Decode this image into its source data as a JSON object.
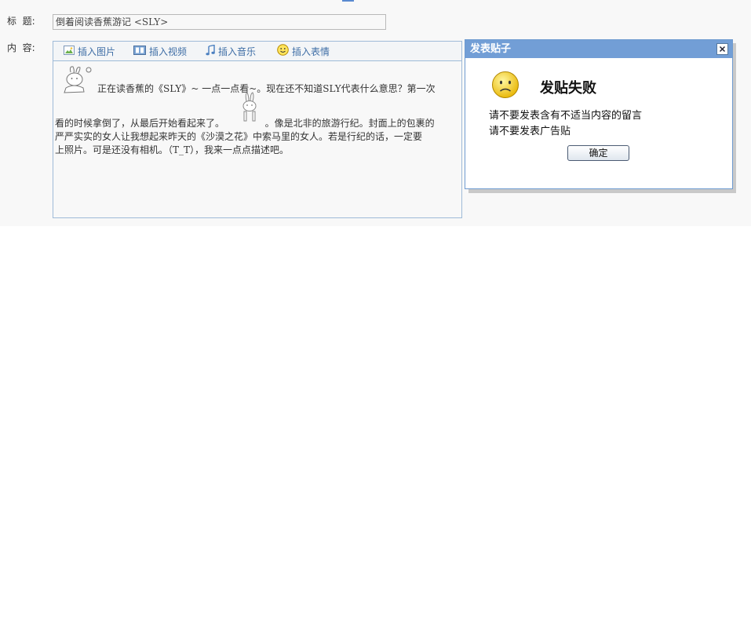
{
  "form": {
    "title_label": "标  题:",
    "title_value": "倒着阅读香蕉游记 <SLY>",
    "content_label": "内  容:"
  },
  "toolbar": {
    "items": [
      {
        "label": "插入图片",
        "icon": "image-icon"
      },
      {
        "label": "插入视频",
        "icon": "video-icon"
      },
      {
        "label": "插入音乐",
        "icon": "music-note-icon"
      },
      {
        "label": "插入表情",
        "icon": "smiley-icon"
      }
    ]
  },
  "content": {
    "line1": "正在读香蕉的《SLY》~ 一点一点看~。现在还不知道SLY代表什么意思？第一次",
    "line2a": "看的时候拿倒了，从最后开始看起来了。",
    "line2b": "。像是北非的旅游行纪。封面上的包裹的",
    "line3": "严严实实的女人让我想起来昨天的《沙漠之花》中索马里的女人。若是行纪的话，一定要",
    "line4": "上照片。可是还没有相机。（T_T），我来一点点描述吧。",
    "emoticons": [
      "rabbit-emoticon-icon",
      "rabbit-emoticon-icon"
    ]
  },
  "dialog": {
    "header_title": "发表贴子",
    "title": "发贴失败",
    "messages": [
      "请不要发表含有不适当内容的留言",
      "请不要发表广告贴"
    ],
    "ok_label": "确定",
    "icon": "sad-face-icon"
  },
  "colors": {
    "dialog_header": "#729ed6",
    "toolbar_text": "#3f6ea6",
    "editor_border": "#9fbbd8"
  }
}
